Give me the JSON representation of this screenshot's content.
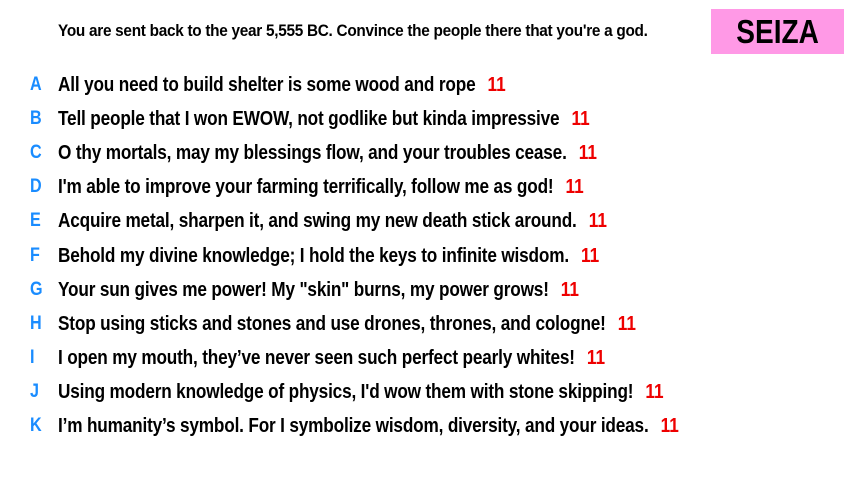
{
  "prompt": "You are sent back to the year 5,555 BC. Convince the people there that you're a god.",
  "title": "SEIZA",
  "colors": {
    "title_bg": "#ff99e6",
    "letter": "#1a8cff",
    "count": "#ee0000"
  },
  "entries": [
    {
      "letter": "A",
      "text": "All you need to build shelter is some wood and rope",
      "count": "11"
    },
    {
      "letter": "B",
      "text": "Tell people that I won EWOW, not godlike but kinda impressive",
      "count": "11"
    },
    {
      "letter": "C",
      "text": "O thy mortals, may my blessings flow, and your troubles cease.",
      "count": "11"
    },
    {
      "letter": "D",
      "text": "I'm able to improve your farming terrifically, follow me as god!",
      "count": "11"
    },
    {
      "letter": "E",
      "text": "Acquire metal, sharpen it, and swing my new death stick around.",
      "count": "11"
    },
    {
      "letter": "F",
      "text": "Behold my divine knowledge; I hold the keys to infinite wisdom.",
      "count": "11"
    },
    {
      "letter": "G",
      "text": "Your sun gives me power! My \"skin\" burns, my power grows!",
      "count": "11"
    },
    {
      "letter": "H",
      "text": "Stop using sticks and stones and use drones, thrones, and cologne!",
      "count": "11"
    },
    {
      "letter": "I",
      "text": "I open my mouth, they’ve never seen such perfect pearly whites!",
      "count": "11"
    },
    {
      "letter": "J",
      "text": "Using modern knowledge of physics, I'd wow them with stone skipping!",
      "count": "11"
    },
    {
      "letter": "K",
      "text": "I’m humanity’s symbol. For I symbolize wisdom, diversity, and your ideas.",
      "count": "11"
    }
  ]
}
